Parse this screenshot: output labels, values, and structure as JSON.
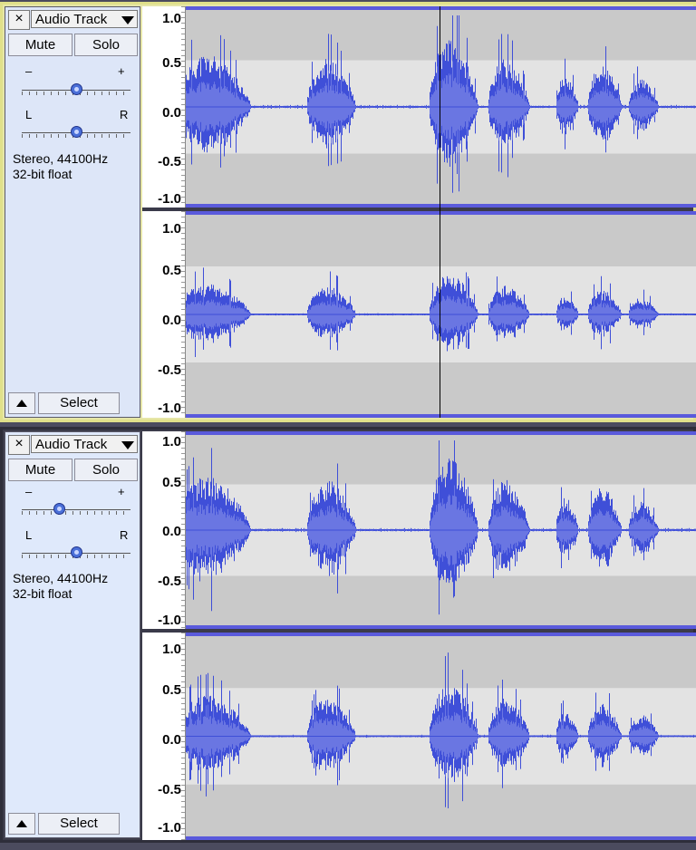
{
  "tracks": [
    {
      "name": "Audio Track",
      "close_symbol": "×",
      "mute_label": "Mute",
      "solo_label": "Solo",
      "gain_minus": "–",
      "gain_plus": "+",
      "pan_left": "L",
      "pan_right": "R",
      "gain_level": 0.5,
      "pan_level": 0.5,
      "format_line1": "Stereo, 44100Hz",
      "format_line2": "32-bit float",
      "select_label": "Select",
      "selected": true
    },
    {
      "name": "Audio Track",
      "close_symbol": "×",
      "mute_label": "Mute",
      "solo_label": "Solo",
      "gain_minus": "–",
      "gain_plus": "+",
      "pan_left": "L",
      "pan_right": "R",
      "gain_level": 0.33,
      "pan_level": 0.5,
      "format_line1": "Stereo, 44100Hz",
      "format_line2": "32-bit float",
      "select_label": "Select",
      "selected": false
    }
  ],
  "amplitude_ticks": [
    "1.0",
    "0.5",
    "0.0",
    "-0.5",
    "-1.0"
  ],
  "colors": {
    "waveform": "#3f4fd8",
    "waveform_rms": "#6a76e2",
    "lane_light": "#e3e3e3",
    "lane_dark": "#c9c9c9",
    "selection_border": "#e6e6a8",
    "cursor": "#000000"
  },
  "icons": {
    "close": "close-icon",
    "menu_dropdown": "chevron-down-icon",
    "collapse": "collapse-up-icon",
    "slider_knob": "slider-knob-icon"
  }
}
